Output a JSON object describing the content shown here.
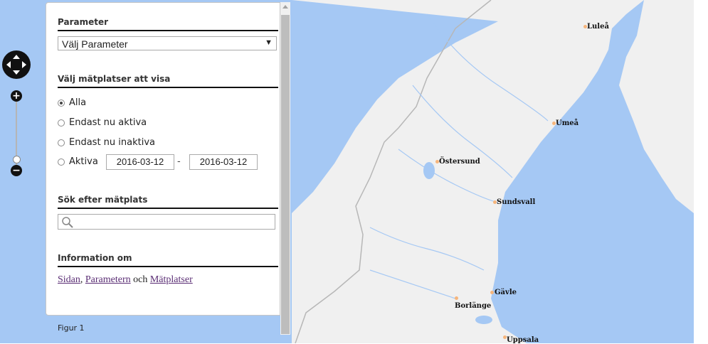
{
  "map": {
    "cities": [
      {
        "name": "Luleå"
      },
      {
        "name": "Umeå"
      },
      {
        "name": "Östersund"
      },
      {
        "name": "Sundsvall"
      },
      {
        "name": "Gävle"
      },
      {
        "name": "Borlänge"
      },
      {
        "name": "Uppsala"
      }
    ],
    "colors": {
      "water": "#a5c8f4",
      "land": "#f0f0f0",
      "border": "#b7b7b7"
    }
  },
  "panel": {
    "parameter": {
      "heading": "Parameter",
      "select_value": "Välj Parameter",
      "select_arrow": "▼"
    },
    "stations": {
      "heading": "Välj mätplatser att visa",
      "options": [
        {
          "label": "Alla",
          "checked": true
        },
        {
          "label": "Endast nu aktiva",
          "checked": false
        },
        {
          "label": "Endast nu inaktiva",
          "checked": false
        },
        {
          "label": "Aktiva",
          "checked": false
        }
      ],
      "date_from": "2016-03-12",
      "date_sep": "-",
      "date_to": "2016-03-12"
    },
    "search": {
      "heading": "Sök efter mätplats",
      "placeholder": ""
    },
    "info": {
      "heading": "Information om",
      "link1": "Sidan",
      "sep": ",",
      "link2": "Parametern",
      "conj": "och",
      "link3": "Mätplatser"
    },
    "figure_label": "Figur 1"
  },
  "controls": {
    "zoom_in": "+",
    "zoom_out": "−",
    "pan": "pan-icon"
  }
}
